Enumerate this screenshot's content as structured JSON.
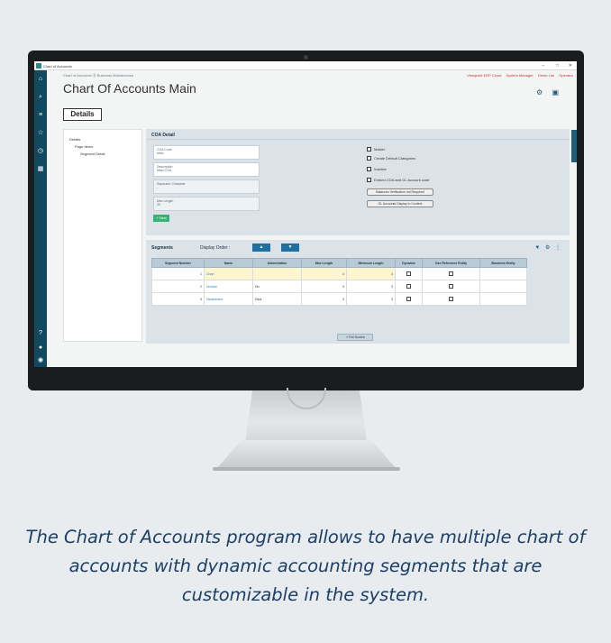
{
  "app": {
    "window_title": "Chart of Accounts",
    "breadcrumb": "Chart of Accounts Ⓢ Business Maintenance",
    "page_title": "Chart Of Accounts Main",
    "top_badges": [
      "Viewpoint ERP Cloud",
      "System Manager",
      "Demo Lite",
      "Operator"
    ],
    "details_tab": "Details",
    "tree": [
      "Details",
      "Page Items",
      "Segment Detail"
    ],
    "coa_panel": {
      "header": "COA Detail",
      "fields": [
        {
          "label": "COA Code",
          "value": "Main"
        },
        {
          "label": "Description",
          "value": "Main COA"
        },
        {
          "label": "Separator Character",
          "value": "-"
        },
        {
          "label": "Max Length",
          "value": "20"
        }
      ],
      "new_button": "+ New",
      "checkboxes": [
        "Master",
        "Create Default Categories",
        "Inactive",
        "Embed COA and GL Account code"
      ],
      "pills": [
        "Balances Verification not Required",
        "GL Accounts Display in Context"
      ]
    },
    "segments": {
      "header": "Segments",
      "display_order_label": "Display Order :",
      "up_button": "▲",
      "down_button": "▼",
      "columns": [
        "Segment Number",
        "Name",
        "Abbreviation",
        "Max Length",
        "Minimum Length",
        "Dynamic",
        "Use Reference Entity",
        "Business Entity"
      ],
      "rows": [
        {
          "number": "1",
          "name": "Chart",
          "abbr": "",
          "max": "4",
          "min": "4"
        },
        {
          "number": "2",
          "name": "Division",
          "abbr": "Div",
          "max": "3",
          "min": "3"
        },
        {
          "number": "3",
          "name": "Department",
          "abbr": "Dept",
          "max": "3",
          "min": "3"
        }
      ],
      "full_screen_button": "↗ Full Screen"
    }
  },
  "caption": "The Chart of Accounts program allows to have multiple chart of accounts with dynamic accounting segments that are customizable in the system."
}
